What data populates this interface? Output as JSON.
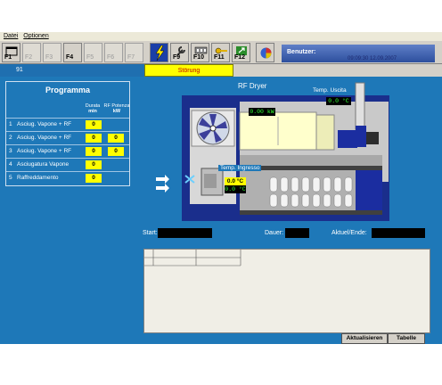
{
  "menu": [
    "Datei",
    "Optionen"
  ],
  "fkeys": [
    {
      "label": "F1",
      "state": "active"
    },
    {
      "label": "F2",
      "state": "disabled"
    },
    {
      "label": "F3",
      "state": "disabled"
    },
    {
      "label": "F4",
      "state": "active"
    },
    {
      "label": "F5",
      "state": "disabled"
    },
    {
      "label": "F6",
      "state": "disabled"
    },
    {
      "label": "F7",
      "state": "disabled"
    },
    {
      "label": "F9",
      "state": "active"
    },
    {
      "label": "F10",
      "state": "active"
    },
    {
      "label": "F11",
      "state": "active"
    },
    {
      "label": "F12",
      "state": "active"
    }
  ],
  "user_label": "Benutzer:",
  "datetime": "09:09:30 12.09.2007",
  "status_left": "91",
  "fault_label": "Störung",
  "program": {
    "title": "Programma",
    "col1": "Durata",
    "col1_unit": "min",
    "col2": "RF Potenza",
    "col2_unit": "kW",
    "rows": [
      {
        "n": "1",
        "label": "Asciug. Vapone + RF",
        "duration": "0",
        "power": ""
      },
      {
        "n": "2",
        "label": "Asciug. Vapone + RF",
        "duration": "0",
        "power": "0"
      },
      {
        "n": "3",
        "label": "Asciug. Vapone + RF",
        "duration": "0",
        "power": "0"
      },
      {
        "n": "4",
        "label": "Asciugatura Vapone",
        "duration": "0",
        "power": ""
      },
      {
        "n": "5",
        "label": "Raffreddamento",
        "duration": "0",
        "power": ""
      }
    ]
  },
  "scene": {
    "title": "RF Dryer",
    "rf_power": "0.00 kW",
    "temp_out_label": "Temp. Uscita",
    "temp_out": "0.0 °C",
    "temp_in_label": "Temp. Ingresso",
    "temp_in_set": "0.0 °C",
    "temp_in_act": "0.0 °C"
  },
  "info": {
    "start_label": "Start:",
    "duration_label": "Dauer:",
    "current_label": "Aktuel/Ende:"
  },
  "buttons": {
    "refresh": "Aktualisieren",
    "table": "Tabelle"
  }
}
